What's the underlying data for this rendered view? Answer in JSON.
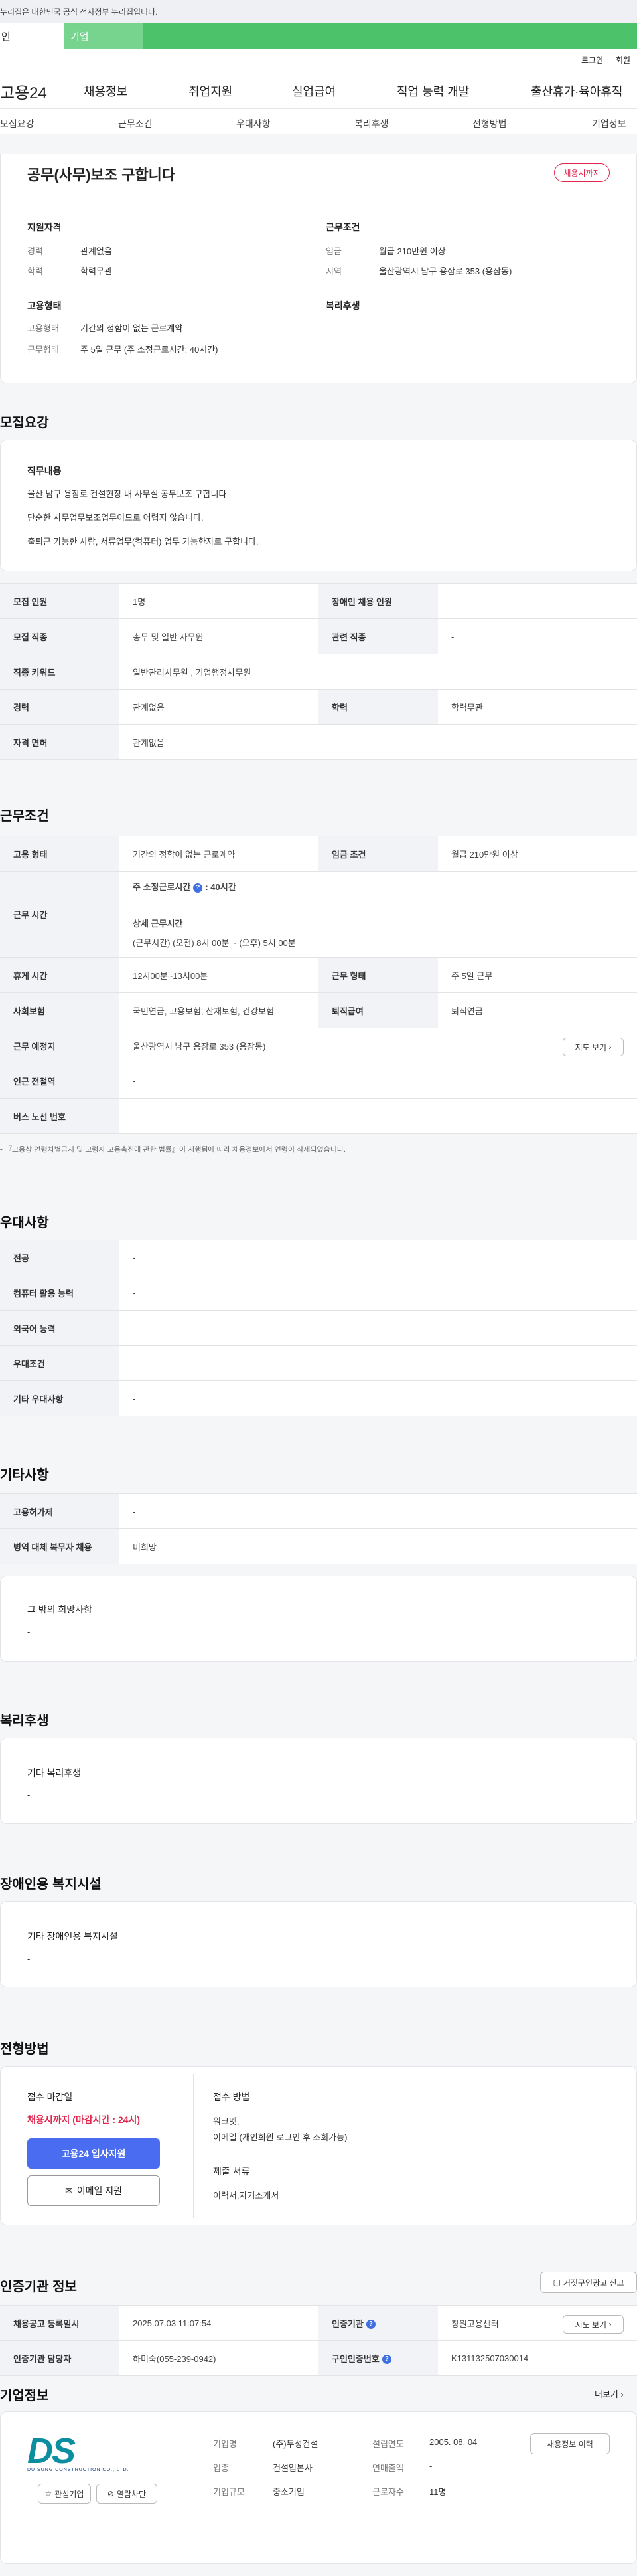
{
  "gov_banner": "이 누리집은 대한민국 공식 전자정부 누리집입니다.",
  "gov_banner_visible": "누리집은 대한민국 공식 전자정부 누리집입니다.",
  "top_tabs": {
    "personal": "개인",
    "personal_visible": "인",
    "corporate": "기업"
  },
  "util": {
    "login": "로그인",
    "signup": "회원"
  },
  "gnb": {
    "logo": "고용24",
    "menu": [
      "채용정보",
      "취업지원",
      "실업급여",
      "직업 능력 개발",
      "출산휴가·육아휴직"
    ]
  },
  "tabs": [
    "모집요강",
    "근무조건",
    "우대사항",
    "복리후생",
    "전형방법",
    "기업정보"
  ],
  "summary": {
    "title": "공무(사무)보조 구합니다",
    "status": "채용시까지",
    "qual_title": "지원자격",
    "cond_title": "근무조건",
    "career_label": "경력",
    "career": "관계없음",
    "edu_label": "학력",
    "edu": "학력무관",
    "wage_label": "임금",
    "wage": "월급 210만원 이상",
    "region_label": "지역",
    "region": "울산광역시 남구 용잠로 353 (용잠동)",
    "emp_title": "고용형태",
    "welfare_title": "복리후생",
    "emp_label": "고용형태",
    "emp": "기간의 정함이 없는 근로계약",
    "work_label": "근무형태",
    "work": "주 5일 근무 (주 소정근로시간: 40시간)"
  },
  "recruit": {
    "title": "모집요강",
    "duty_title": "직무내용",
    "duty_lines": [
      "울산 남구 용잠로 건설현장 내 사무실 공무보조 구합니다",
      "단순한 사무업무보조업무이므로 어렵지 않습니다.",
      "출퇴근 가능한 사람, 서류업무(컴퓨터) 업무 가능한자로 구합니다."
    ],
    "rows": {
      "count_h": "모집 인원",
      "count": "1명",
      "disabled_h": "장애인 채용 인원",
      "disabled": "-",
      "job_h": "모집 직종",
      "job": "총무 및 일반 사무원",
      "rel_h": "관련 직종",
      "rel": "-",
      "kw_h": "직종 키워드",
      "kw": "일반관리사무원 , 기업행정사무원",
      "career_h": "경력",
      "career": "관계없음",
      "edu_h": "학력",
      "edu": "학력무관",
      "lic_h": "자격 면허",
      "lic": "관계없음"
    }
  },
  "conditions": {
    "title": "근무조건",
    "emp_h": "고용 형태",
    "emp": "기간의 정함이 없는 근로계약",
    "wage_h": "임금 조건",
    "wage": "월급 210만원 이상",
    "time_h": "근무 시간",
    "weekly_label": "주 소정근로시간",
    "weekly_value": ": 40시간",
    "detail_title": "상세 근무시간",
    "detail": "(근무시간) (오전) 8시 00분 ~ (오후) 5시 00분",
    "rest_h": "휴게 시간",
    "rest": "12시00분~13시00분",
    "form_h": "근무 형태",
    "form": "주 5일 근무",
    "ins_h": "사회보험",
    "ins": "국민연금, 고용보험, 산재보험, 건강보험",
    "ret_h": "퇴직급여",
    "ret": "퇴직연금",
    "place_h": "근무 예정지",
    "place": "울산광역시 남구 용잠로 353 (용잠동)",
    "map_btn": "지도 보기",
    "subway_h": "인근 전철역",
    "subway": "-",
    "bus_h": "버스 노선 번호",
    "bus": "-",
    "note": "『고용상 연령차별금지 및 고령자 고용촉진에 관한 법률』이 시행됨에 따라 채용정보에서 연령이 삭제되었습니다."
  },
  "preference": {
    "title": "우대사항",
    "major_h": "전공",
    "major": "-",
    "pc_h": "컴퓨터 활용 능력",
    "pc": "-",
    "lang_h": "외국어 능력",
    "lang": "-",
    "cond_h": "우대조건",
    "cond": "-",
    "etc_h": "기타 우대사항",
    "etc": "-"
  },
  "etc": {
    "title": "기타사항",
    "permit_h": "고용허가제",
    "permit": "-",
    "army_h": "병역 대체 복무자 채용",
    "army": "비희망",
    "hope_title": "그 밖의 희망사항",
    "hope": "-"
  },
  "welfare": {
    "title": "복리후생",
    "sub": "기타 복리후생",
    "val": "-"
  },
  "facility": {
    "title": "장애인용 복지시설",
    "sub": "기타 장애인용 복지시설",
    "val": "-"
  },
  "selection": {
    "title": "전형방법",
    "deadline_title": "접수 마감일",
    "deadline": "채용시까지 (마감시간 : 24시)",
    "apply_btn": "고용24 입사지원",
    "email_btn": "이메일 지원",
    "method_title": "접수 방법",
    "method1": "워크넷,",
    "method2": "이메일 (개인회원 로그인 후 조회가능)",
    "docs_title": "제출 서류",
    "docs": "이력서,자기소개서"
  },
  "cert": {
    "title": "인증기관 정보",
    "report_btn": "거짓구인광고 신고",
    "reg_h": "채용공고 등록일시",
    "reg": "2025.07.03 11:07:54",
    "org_h": "인증기관",
    "org": "창원고용센터",
    "map_btn": "지도 보기",
    "mgr_h": "인증기관 담당자",
    "mgr": "하미숙(055-239-0942)",
    "no_h": "구인인증번호",
    "no": "K131132507030014"
  },
  "company": {
    "title": "기업정보",
    "more": "더보기",
    "logo_main": "DS",
    "logo_sub": "DU SUNG CONSTRUCTION CO., LTD.",
    "fav_btn": "관심기업",
    "block_btn": "열람차단",
    "name_h": "기업명",
    "name": "(주)두성건설",
    "ind_h": "업종",
    "ind": "건설업본사",
    "size_h": "기업규모",
    "size": "중소기업",
    "est_h": "설립연도",
    "est": "2005. 08. 04",
    "sales_h": "연매출액",
    "sales": "-",
    "emp_h": "근로자수",
    "emp": "11명",
    "hist_btn": "채용정보 이력"
  },
  "colors": {
    "accent": "#4cc26a",
    "apply": "#4a6cf0",
    "alert": "#e2264d"
  }
}
